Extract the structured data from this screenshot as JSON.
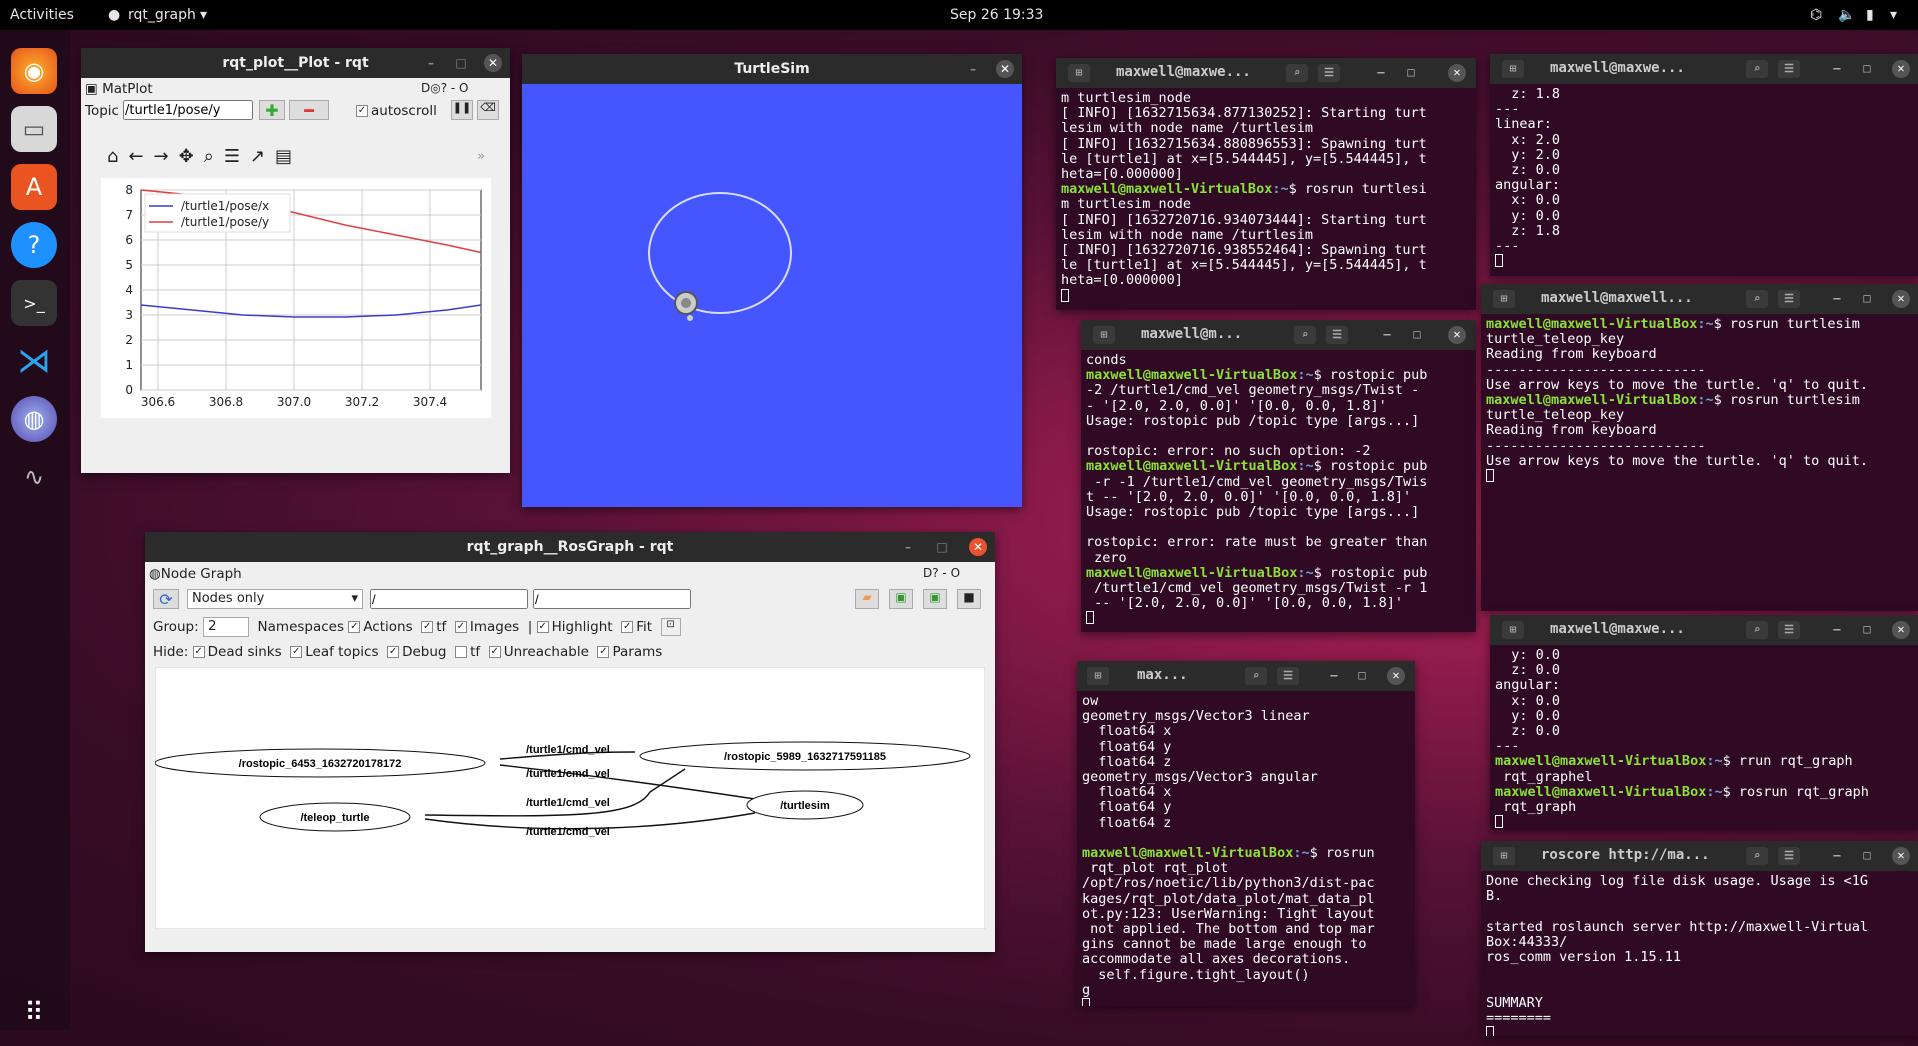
{
  "topbar": {
    "activities": "Activities",
    "app": "rqt_graph",
    "clock": "Sep 26  19:33"
  },
  "dock": {
    "items": [
      "firefox-icon",
      "files-icon",
      "software-icon",
      "help-icon",
      "terminal-icon",
      "vscode-icon",
      "rqt-icon",
      "monitor-icon",
      "apps-grid-icon"
    ]
  },
  "plot": {
    "title": "rqt_plot__Plot - rqt",
    "plugin": "MatPlot",
    "topic_label": "Topic",
    "topic_value": "/turtle1/pose/y",
    "autoscroll": "autoscroll",
    "legend": [
      "/turtle1/pose/x",
      "/turtle1/pose/y"
    ]
  },
  "chart_data": {
    "type": "line",
    "x": [
      306.6,
      306.8,
      307.0,
      307.2,
      307.4
    ],
    "xlim": [
      306.55,
      307.55
    ],
    "ylim": [
      0,
      8
    ],
    "yticks": [
      "0",
      "1",
      "2",
      "3",
      "4",
      "5",
      "6",
      "7",
      "8"
    ],
    "xticks": [
      "306.6",
      "306.8",
      "307.0",
      "307.2",
      "307.4"
    ],
    "series": [
      {
        "name": "/turtle1/pose/x",
        "color": "#3b3bcc",
        "x": [
          306.55,
          306.7,
          306.85,
          307.0,
          307.15,
          307.3,
          307.45,
          307.55
        ],
        "values": [
          3.4,
          3.2,
          3.0,
          2.92,
          2.92,
          3.0,
          3.2,
          3.4
        ]
      },
      {
        "name": "/turtle1/pose/y",
        "color": "#e04040",
        "x": [
          306.55,
          306.7,
          306.85,
          307.0,
          307.15,
          307.3,
          307.45,
          307.55
        ],
        "values": [
          8.0,
          7.8,
          7.5,
          7.1,
          6.6,
          6.2,
          5.8,
          5.5
        ]
      }
    ]
  },
  "turtlesim": {
    "title": "TurtleSim"
  },
  "graph": {
    "title": "rqt_graph__RosGraph - rqt",
    "plugin": "Node Graph",
    "mode": "Nodes only",
    "filter1": "/",
    "filter2": "/",
    "group_label": "Group:",
    "group_value": "2",
    "hide_label": "Hide:",
    "opts": [
      "Namespaces",
      "Actions",
      "tf",
      "Images",
      "Highlight",
      "Fit"
    ],
    "hides": [
      "Dead sinks",
      "Leaf topics",
      "Debug",
      "tf",
      "Unreachable",
      "Params"
    ],
    "nodes": [
      "/rostopic_6453_1632720178172",
      "/rostopic_5989_1632717591185",
      "/teleop_turtle",
      "/turtlesim"
    ],
    "edges": [
      "/turtle1/cmd_vel",
      "/turtle1/cmd_vel",
      "/turtle1/cmd_vel",
      "/turtle1/cmd_vel"
    ]
  },
  "term1": {
    "title": "maxwell@maxwe...",
    "lines": [
      "m turtlesim_node",
      "[ INFO] [1632715634.877130252]: Starting turt",
      "lesim with node name /turtlesim",
      "[ INFO] [1632715634.880896553]: Spawning turt",
      "le [turtle1] at x=[5.544445], y=[5.544445], t",
      "heta=[0.000000]",
      "maxwell@maxwell-VirtualBox:~$ rosrun turtlesi",
      "m turtlesim_node",
      "[ INFO] [1632720716.934073444]: Starting turt",
      "lesim with node name /turtlesim",
      "[ INFO] [1632720716.938552464]: Spawning turt",
      "le [turtle1] at x=[5.544445], y=[5.544445], t",
      "heta=[0.000000]"
    ]
  },
  "term2": {
    "title": "maxwell@m...",
    "lines": [
      "conds",
      "maxwell@maxwell-VirtualBox:~$ rostopic pub",
      "-2 /turtle1/cmd_vel geometry_msgs/Twist -",
      "- '[2.0, 2.0, 0.0]' '[0.0, 0.0, 1.8]'",
      "Usage: rostopic pub /topic type [args...]",
      "",
      "rostopic: error: no such option: -2",
      "maxwell@maxwell-VirtualBox:~$ rostopic pub",
      " -r -1 /turtle1/cmd_vel geometry_msgs/Twis",
      "t -- '[2.0, 2.0, 0.0]' '[0.0, 0.0, 1.8]'",
      "Usage: rostopic pub /topic type [args...]",
      "",
      "rostopic: error: rate must be greater than",
      " zero",
      "maxwell@maxwell-VirtualBox:~$ rostopic pub",
      " /turtle1/cmd_vel geometry_msgs/Twist -r 1",
      " -- '[2.0, 2.0, 0.0]' '[0.0, 0.0, 1.8]'"
    ]
  },
  "term3": {
    "title": "max...",
    "lines": [
      "ow",
      "geometry_msgs/Vector3 linear",
      "  float64 x",
      "  float64 y",
      "  float64 z",
      "geometry_msgs/Vector3 angular",
      "  float64 x",
      "  float64 y",
      "  float64 z",
      "",
      "maxwell@maxwell-VirtualBox:~$ rosrun",
      " rqt_plot rqt_plot",
      "/opt/ros/noetic/lib/python3/dist-pac",
      "kages/rqt_plot/data_plot/mat_data_pl",
      "ot.py:123: UserWarning: Tight layout",
      " not applied. The bottom and top mar",
      "gins cannot be made large enough to",
      "accommodate all axes decorations.",
      "  self.figure.tight_layout()",
      "g"
    ]
  },
  "term4": {
    "title": "maxwell@maxwe...",
    "lines": [
      "  z: 1.8",
      "---",
      "linear:",
      "  x: 2.0",
      "  y: 2.0",
      "  z: 0.0",
      "angular:",
      "  x: 0.0",
      "  y: 0.0",
      "  z: 1.8",
      "---"
    ]
  },
  "term5": {
    "title": "maxwell@maxwell...",
    "lines": [
      "maxwell@maxwell-VirtualBox:~$ rosrun turtlesim",
      "turtle_teleop_key",
      "Reading from keyboard",
      "---------------------------",
      "Use arrow keys to move the turtle. 'q' to quit.",
      "maxwell@maxwell-VirtualBox:~$ rosrun turtlesim",
      "turtle_teleop_key",
      "Reading from keyboard",
      "---------------------------",
      "Use arrow keys to move the turtle. 'q' to quit."
    ]
  },
  "term6": {
    "title": "maxwell@maxwe...",
    "lines": [
      "  y: 0.0",
      "  z: 0.0",
      "angular:",
      "  x: 0.0",
      "  y: 0.0",
      "  z: 0.0",
      "---",
      "maxwell@maxwell-VirtualBox:~$ rrun rqt_graph",
      " rqt_graphel",
      "maxwell@maxwell-VirtualBox:~$ rosrun rqt_graph",
      " rqt_graph"
    ]
  },
  "term7": {
    "title": "roscore http://ma...",
    "lines": [
      "Done checking log file disk usage. Usage is <1G",
      "B.",
      "",
      "started roslaunch server http://maxwell-Virtual",
      "Box:44333/",
      "ros_comm version 1.15.11",
      "",
      "",
      "SUMMARY",
      "========"
    ]
  }
}
